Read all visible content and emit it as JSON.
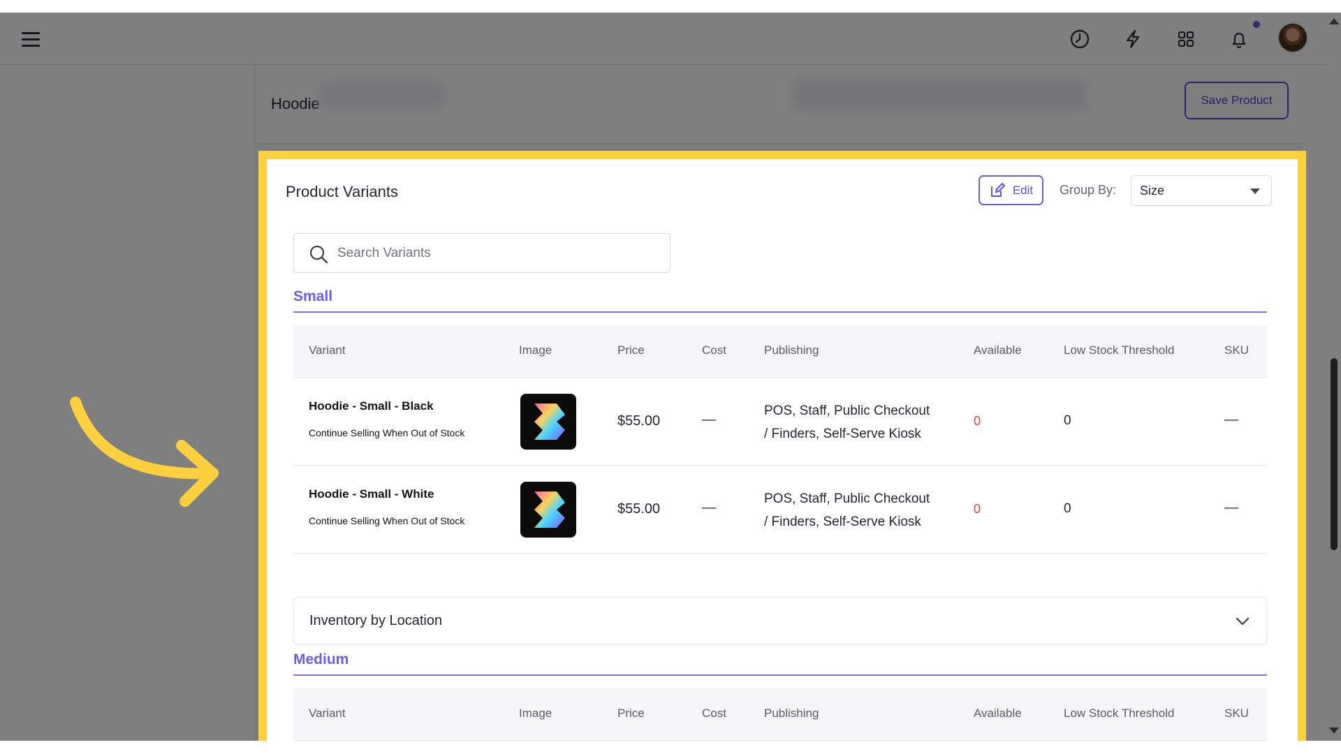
{
  "topbar": {
    "icons": [
      "menu-icon",
      "clock-icon",
      "lightning-icon",
      "grid-icon",
      "bell-icon"
    ],
    "notification_dot_color": "#6b5ce7"
  },
  "page": {
    "title": "Hoodie",
    "save_label": "Save Product"
  },
  "card": {
    "title": "Product Variants",
    "edit_label": "Edit",
    "group_by_label": "Group By:",
    "group_by_value": "Size",
    "search_placeholder": "Search Variants"
  },
  "columns": [
    "Variant",
    "Image",
    "Price",
    "Cost",
    "Publishing",
    "Available",
    "Low Stock Threshold",
    "SKU"
  ],
  "groups": [
    {
      "name": "Small",
      "rows": [
        {
          "variant": "Hoodie - Small - Black",
          "subtext": "Continue Selling When Out of Stock",
          "price": "$55.00",
          "cost": "—",
          "publishing_line1": "POS, Staff, Public Checkout",
          "publishing_line2": "/ Finders, Self-Serve Kiosk",
          "available": "0",
          "low_stock_threshold": "0",
          "sku": "—"
        },
        {
          "variant": "Hoodie - Small - White",
          "subtext": "Continue Selling When Out of Stock",
          "price": "$55.00",
          "cost": "—",
          "publishing_line1": "POS, Staff, Public Checkout",
          "publishing_line2": "/ Finders, Self-Serve Kiosk",
          "available": "0",
          "low_stock_threshold": "0",
          "sku": "—"
        }
      ],
      "inventory_label": "Inventory by Location"
    },
    {
      "name": "Medium"
    }
  ],
  "colors": {
    "accent": "#6a5ce6",
    "highlight": "#fcd03e",
    "available_zero": "#e0433b"
  }
}
